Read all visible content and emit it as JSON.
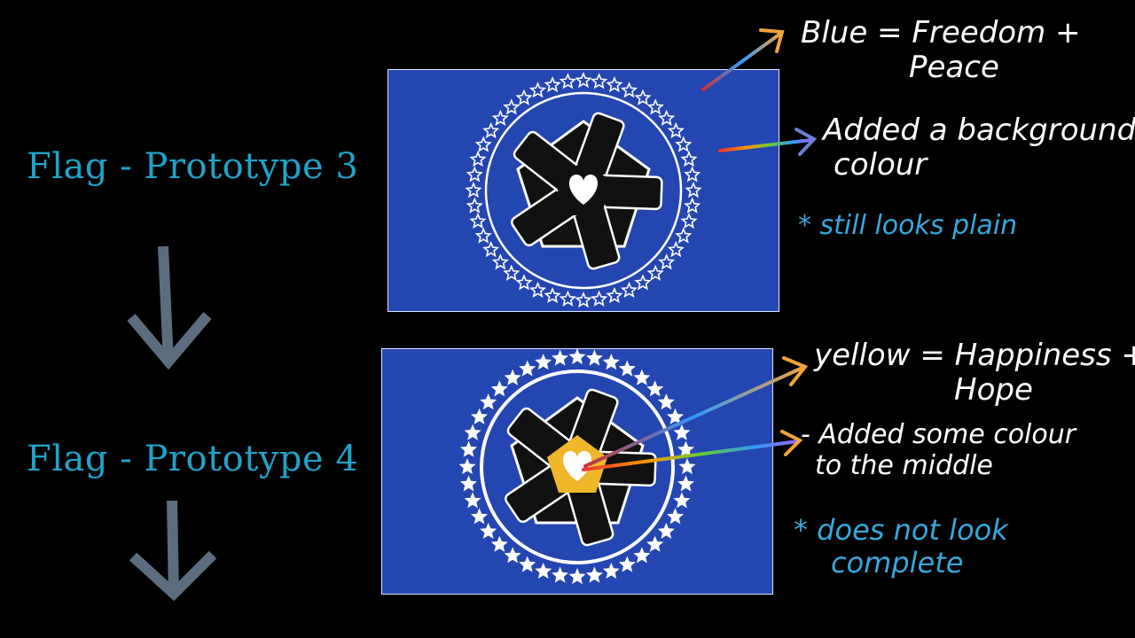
{
  "colors": {
    "background": "#000000",
    "flag_blue": "#2446b0",
    "heading_teal": "#1fa3c9",
    "note_white": "#ffffff",
    "note_cyan": "#35a8dd",
    "arrow_grey": "#5d6d80",
    "yellow_center": "#f0b72a"
  },
  "labels": {
    "prototype3": "Flag - Prototype 3",
    "prototype4": "Flag - Prototype 4"
  },
  "notes": {
    "p3_blue_line1": "Blue = Freedom +",
    "p3_blue_line2": "Peace",
    "p3_added_line1": "Added a background",
    "p3_added_line2": "colour",
    "p3_comment": "* still looks plain",
    "p4_yellow_line1": "yellow = Happiness +",
    "p4_yellow_line2": "Hope",
    "p4_added_line1": "- Added some colour",
    "p4_added_line2": "to the middle",
    "p4_comment_line1": "* does not look",
    "p4_comment_line2": "complete"
  },
  "icons": {
    "flow_arrow": "down-arrow-icon",
    "pointer_arrow": "hand-drawn-arrow-icon",
    "emblem": "joined-hands-heart-icon",
    "ring": "star-ring-icon"
  }
}
